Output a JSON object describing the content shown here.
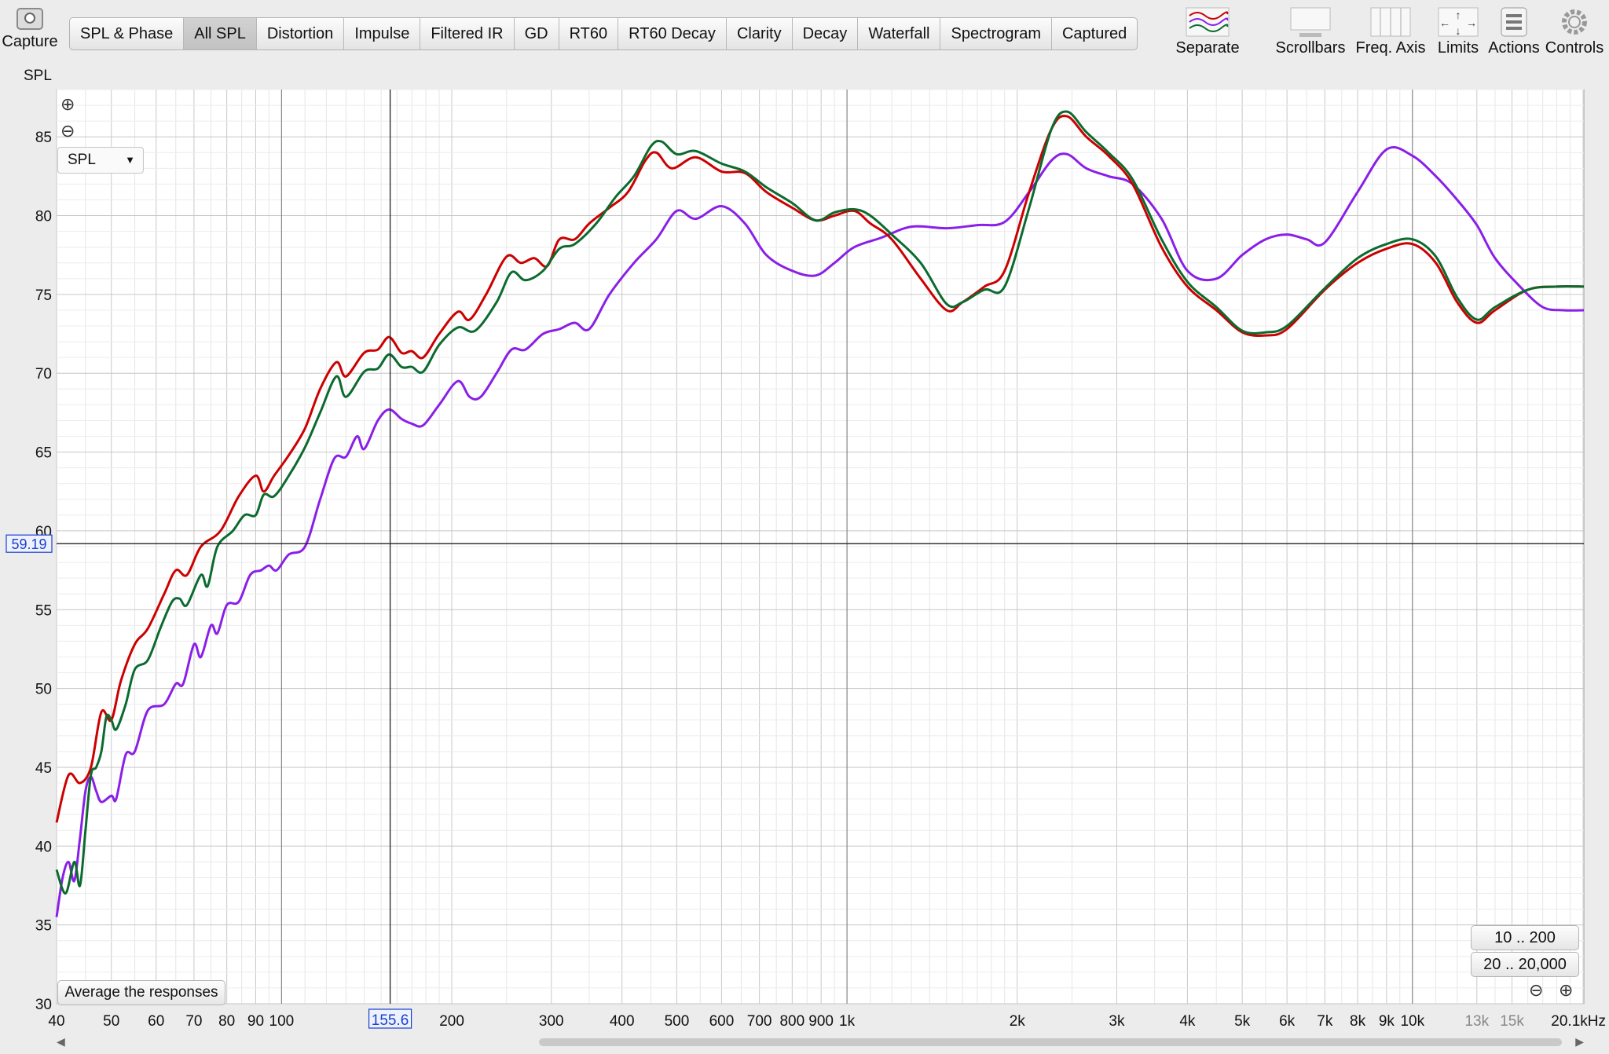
{
  "toolbar": {
    "capture_label": "Capture",
    "tabs": [
      "SPL & Phase",
      "All SPL",
      "Distortion",
      "Impulse",
      "Filtered IR",
      "GD",
      "RT60",
      "RT60 Decay",
      "Clarity",
      "Decay",
      "Waterfall",
      "Spectrogram",
      "Captured"
    ],
    "active_tab": "All SPL",
    "tools": [
      {
        "label": "Separate",
        "icon": "separate-traces-icon"
      },
      {
        "label": "Scrollbars",
        "icon": "scrollbars-icon"
      },
      {
        "label": "Freq. Axis",
        "icon": "freq-axis-icon"
      },
      {
        "label": "Limits",
        "icon": "limits-icon"
      },
      {
        "label": "Actions",
        "icon": "actions-icon"
      },
      {
        "label": "Controls",
        "icon": "controls-gear-icon"
      }
    ]
  },
  "plot_controls": {
    "zoom_in": "⊕",
    "zoom_out": "⊖",
    "dropdown_value": "SPL",
    "average_button": "Average the responses",
    "range_low": "10 .. 200",
    "range_high": "20 .. 20,000"
  },
  "cursor": {
    "y_value": "59.19",
    "x_value": "155.6"
  },
  "chart_data": {
    "type": "line",
    "ylabel": "SPL",
    "xlabel": "",
    "x_scale": "log",
    "xlim": [
      40,
      20100
    ],
    "ylim": [
      30,
      88
    ],
    "grid": true,
    "x_ticks": [
      {
        "v": 40,
        "t": "40"
      },
      {
        "v": 50,
        "t": "50"
      },
      {
        "v": 60,
        "t": "60"
      },
      {
        "v": 70,
        "t": "70"
      },
      {
        "v": 80,
        "t": "80"
      },
      {
        "v": 90,
        "t": "90"
      },
      {
        "v": 100,
        "t": "100"
      },
      {
        "v": 200,
        "t": "200"
      },
      {
        "v": 300,
        "t": "300"
      },
      {
        "v": 400,
        "t": "400"
      },
      {
        "v": 500,
        "t": "500"
      },
      {
        "v": 600,
        "t": "600"
      },
      {
        "v": 700,
        "t": "700"
      },
      {
        "v": 800,
        "t": "800"
      },
      {
        "v": 900,
        "t": "900"
      },
      {
        "v": 1000,
        "t": "1k"
      },
      {
        "v": 2000,
        "t": "2k"
      },
      {
        "v": 3000,
        "t": "3k"
      },
      {
        "v": 4000,
        "t": "4k"
      },
      {
        "v": 5000,
        "t": "5k"
      },
      {
        "v": 6000,
        "t": "6k"
      },
      {
        "v": 7000,
        "t": "7k"
      },
      {
        "v": 8000,
        "t": "8k"
      },
      {
        "v": 9000,
        "t": "9k"
      },
      {
        "v": 10000,
        "t": "10k"
      },
      {
        "v": 13000,
        "t": "13k"
      },
      {
        "v": 15000,
        "t": "15k"
      },
      {
        "v": 20100,
        "t": "20.1kHz"
      }
    ],
    "y_ticks": [
      30,
      35,
      40,
      45,
      50,
      55,
      60,
      65,
      70,
      75,
      80,
      85
    ],
    "series": [
      {
        "color": "#cc0000",
        "points": [
          [
            40,
            41.5
          ],
          [
            42,
            44.5
          ],
          [
            44,
            44
          ],
          [
            46,
            45
          ],
          [
            48,
            48.5
          ],
          [
            50,
            48
          ],
          [
            52,
            50.5
          ],
          [
            55,
            52.8
          ],
          [
            58,
            53.8
          ],
          [
            62,
            56
          ],
          [
            65,
            57.5
          ],
          [
            68,
            57.2
          ],
          [
            72,
            59
          ],
          [
            78,
            60
          ],
          [
            84,
            62.2
          ],
          [
            90,
            63.5
          ],
          [
            93,
            62.5
          ],
          [
            97,
            63.5
          ],
          [
            103,
            64.8
          ],
          [
            110,
            66.5
          ],
          [
            117,
            69
          ],
          [
            125,
            70.7
          ],
          [
            130,
            69.8
          ],
          [
            140,
            71.3
          ],
          [
            148,
            71.5
          ],
          [
            155,
            72.3
          ],
          [
            163,
            71.3
          ],
          [
            170,
            71.4
          ],
          [
            178,
            71
          ],
          [
            190,
            72.5
          ],
          [
            205,
            73.9
          ],
          [
            215,
            73.4
          ],
          [
            230,
            75
          ],
          [
            250,
            77.4
          ],
          [
            265,
            77
          ],
          [
            280,
            77.3
          ],
          [
            295,
            76.8
          ],
          [
            310,
            78.5
          ],
          [
            330,
            78.5
          ],
          [
            350,
            79.5
          ],
          [
            380,
            80.5
          ],
          [
            410,
            81.5
          ],
          [
            440,
            83.5
          ],
          [
            460,
            84
          ],
          [
            490,
            83
          ],
          [
            540,
            83.7
          ],
          [
            600,
            82.8
          ],
          [
            660,
            82.7
          ],
          [
            720,
            81.5
          ],
          [
            800,
            80.5
          ],
          [
            880,
            79.7
          ],
          [
            950,
            80
          ],
          [
            1030,
            80.3
          ],
          [
            1100,
            79.5
          ],
          [
            1200,
            78.5
          ],
          [
            1350,
            76
          ],
          [
            1500,
            74
          ],
          [
            1600,
            74.5
          ],
          [
            1750,
            75.5
          ],
          [
            1900,
            76.5
          ],
          [
            2100,
            81.5
          ],
          [
            2300,
            85.5
          ],
          [
            2450,
            86.3
          ],
          [
            2650,
            85
          ],
          [
            2900,
            83.8
          ],
          [
            3200,
            82
          ],
          [
            3600,
            78
          ],
          [
            4000,
            75.5
          ],
          [
            4500,
            74
          ],
          [
            5000,
            72.6
          ],
          [
            5500,
            72.4
          ],
          [
            6000,
            72.8
          ],
          [
            7000,
            75.3
          ],
          [
            8000,
            77
          ],
          [
            9000,
            77.9
          ],
          [
            10000,
            78.2
          ],
          [
            11000,
            77
          ],
          [
            12000,
            74.5
          ],
          [
            13000,
            73.2
          ],
          [
            14000,
            74
          ],
          [
            16000,
            75.3
          ],
          [
            18000,
            75.5
          ],
          [
            20100,
            75.5
          ]
        ]
      },
      {
        "color": "#0b6b2e",
        "points": [
          [
            40,
            38.5
          ],
          [
            41.5,
            37
          ],
          [
            43,
            39
          ],
          [
            44,
            37.5
          ],
          [
            45,
            41
          ],
          [
            46,
            44.5
          ],
          [
            47,
            45
          ],
          [
            48,
            46
          ],
          [
            49,
            48.2
          ],
          [
            50,
            48
          ],
          [
            51,
            47.4
          ],
          [
            53,
            49
          ],
          [
            55,
            51.2
          ],
          [
            58,
            51.8
          ],
          [
            61,
            53.8
          ],
          [
            64,
            55.5
          ],
          [
            66,
            55.7
          ],
          [
            68,
            55.3
          ],
          [
            72,
            57.2
          ],
          [
            74,
            56.5
          ],
          [
            77,
            59
          ],
          [
            82,
            60
          ],
          [
            86,
            61
          ],
          [
            90,
            61
          ],
          [
            93,
            62.3
          ],
          [
            97,
            62.2
          ],
          [
            103,
            63.5
          ],
          [
            110,
            65.3
          ],
          [
            117,
            67.5
          ],
          [
            125,
            69.8
          ],
          [
            130,
            68.5
          ],
          [
            140,
            70.1
          ],
          [
            148,
            70.3
          ],
          [
            155,
            71.2
          ],
          [
            163,
            70.4
          ],
          [
            170,
            70.4
          ],
          [
            178,
            70.1
          ],
          [
            190,
            71.8
          ],
          [
            205,
            72.9
          ],
          [
            220,
            72.7
          ],
          [
            240,
            74.5
          ],
          [
            255,
            76.4
          ],
          [
            270,
            75.9
          ],
          [
            290,
            76.5
          ],
          [
            310,
            77.9
          ],
          [
            330,
            78.2
          ],
          [
            360,
            79.5
          ],
          [
            390,
            81.2
          ],
          [
            420,
            82.5
          ],
          [
            450,
            84.4
          ],
          [
            470,
            84.7
          ],
          [
            500,
            83.9
          ],
          [
            540,
            84.1
          ],
          [
            600,
            83.3
          ],
          [
            660,
            82.8
          ],
          [
            720,
            81.8
          ],
          [
            800,
            80.8
          ],
          [
            880,
            79.7
          ],
          [
            950,
            80.2
          ],
          [
            1030,
            80.4
          ],
          [
            1100,
            80
          ],
          [
            1200,
            78.8
          ],
          [
            1350,
            77
          ],
          [
            1500,
            74.4
          ],
          [
            1600,
            74.5
          ],
          [
            1750,
            75.3
          ],
          [
            1900,
            75.5
          ],
          [
            2100,
            80.5
          ],
          [
            2300,
            85.5
          ],
          [
            2450,
            86.6
          ],
          [
            2650,
            85.3
          ],
          [
            2900,
            84
          ],
          [
            3200,
            82.3
          ],
          [
            3600,
            78.5
          ],
          [
            4000,
            75.8
          ],
          [
            4500,
            74.2
          ],
          [
            5000,
            72.7
          ],
          [
            5500,
            72.6
          ],
          [
            6000,
            73
          ],
          [
            7000,
            75.4
          ],
          [
            8000,
            77.3
          ],
          [
            9000,
            78.2
          ],
          [
            10000,
            78.5
          ],
          [
            11000,
            77.4
          ],
          [
            12000,
            74.8
          ],
          [
            13000,
            73.4
          ],
          [
            14000,
            74.2
          ],
          [
            16000,
            75.3
          ],
          [
            18000,
            75.5
          ],
          [
            20100,
            75.5
          ]
        ]
      },
      {
        "color": "#8a1fe8",
        "points": [
          [
            40,
            35.5
          ],
          [
            41,
            38
          ],
          [
            42,
            39
          ],
          [
            43,
            37.8
          ],
          [
            44,
            40.5
          ],
          [
            45,
            43.5
          ],
          [
            46,
            44.4
          ],
          [
            47,
            43.5
          ],
          [
            48,
            42.8
          ],
          [
            50,
            43.2
          ],
          [
            51,
            43
          ],
          [
            53,
            45.8
          ],
          [
            55,
            46
          ],
          [
            58,
            48.6
          ],
          [
            62,
            49
          ],
          [
            65,
            50.3
          ],
          [
            67,
            50.3
          ],
          [
            70,
            52.8
          ],
          [
            72,
            52
          ],
          [
            75,
            54
          ],
          [
            77,
            53.5
          ],
          [
            80,
            55.3
          ],
          [
            84,
            55.5
          ],
          [
            88,
            57.2
          ],
          [
            92,
            57.5
          ],
          [
            95,
            57.8
          ],
          [
            98,
            57.5
          ],
          [
            103,
            58.5
          ],
          [
            110,
            59
          ],
          [
            117,
            62
          ],
          [
            124,
            64.6
          ],
          [
            130,
            64.7
          ],
          [
            136,
            66
          ],
          [
            140,
            65.2
          ],
          [
            148,
            67
          ],
          [
            155,
            67.7
          ],
          [
            163,
            67.1
          ],
          [
            170,
            66.8
          ],
          [
            178,
            66.7
          ],
          [
            190,
            68
          ],
          [
            205,
            69.5
          ],
          [
            215,
            68.5
          ],
          [
            225,
            68.5
          ],
          [
            240,
            70
          ],
          [
            255,
            71.5
          ],
          [
            270,
            71.5
          ],
          [
            290,
            72.5
          ],
          [
            310,
            72.8
          ],
          [
            330,
            73.2
          ],
          [
            350,
            72.8
          ],
          [
            380,
            75
          ],
          [
            420,
            77
          ],
          [
            460,
            78.5
          ],
          [
            500,
            80.3
          ],
          [
            540,
            79.8
          ],
          [
            600,
            80.6
          ],
          [
            660,
            79.5
          ],
          [
            720,
            77.5
          ],
          [
            800,
            76.5
          ],
          [
            880,
            76.2
          ],
          [
            950,
            77
          ],
          [
            1030,
            78
          ],
          [
            1150,
            78.6
          ],
          [
            1300,
            79.3
          ],
          [
            1500,
            79.2
          ],
          [
            1700,
            79.4
          ],
          [
            1900,
            79.6
          ],
          [
            2100,
            81.5
          ],
          [
            2300,
            83.5
          ],
          [
            2450,
            83.9
          ],
          [
            2650,
            83
          ],
          [
            2900,
            82.5
          ],
          [
            3200,
            82
          ],
          [
            3600,
            79.8
          ],
          [
            4000,
            76.5
          ],
          [
            4500,
            76
          ],
          [
            5000,
            77.5
          ],
          [
            5500,
            78.5
          ],
          [
            6000,
            78.8
          ],
          [
            6500,
            78.5
          ],
          [
            7000,
            78.3
          ],
          [
            8000,
            81.5
          ],
          [
            9000,
            84.2
          ],
          [
            10000,
            83.8
          ],
          [
            11000,
            82.5
          ],
          [
            12000,
            81
          ],
          [
            13000,
            79.4
          ],
          [
            14000,
            77.3
          ],
          [
            15500,
            75.5
          ],
          [
            17000,
            74.2
          ],
          [
            18500,
            74
          ],
          [
            20100,
            74
          ]
        ]
      }
    ]
  }
}
